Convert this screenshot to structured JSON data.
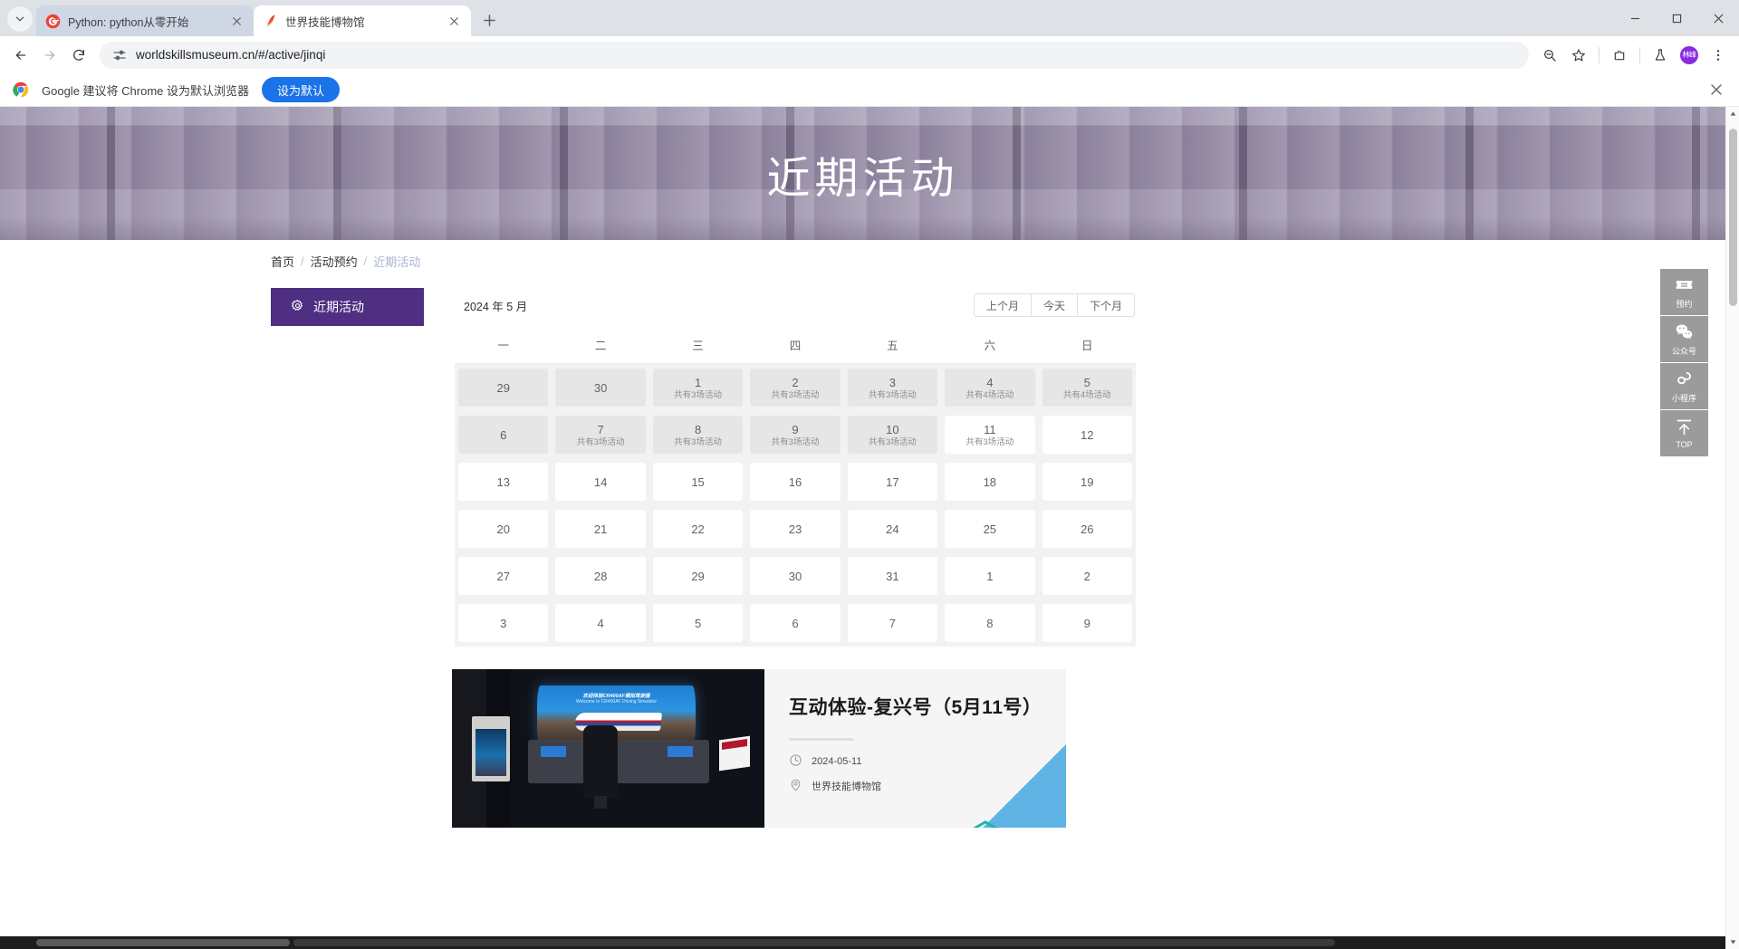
{
  "browser": {
    "tabs": [
      {
        "title": "Python: python从零开始",
        "favicon": "google-g-icon",
        "active": false
      },
      {
        "title": "世界技能博物馆",
        "favicon": "museum-icon",
        "active": true
      }
    ],
    "new_tab_label": "+",
    "url": "worldskillsmuseum.cn/#/active/jinqi",
    "profile_initials": "林峰",
    "window_controls": {
      "minimize": "minimize",
      "maximize": "maximize",
      "close": "close"
    },
    "toolbar_icons": [
      "back-icon",
      "forward-icon",
      "reload-icon",
      "site-info-icon",
      "zoom-out-icon",
      "bookmark-star-icon",
      "extensions-icon",
      "labs-flask-icon",
      "profile-avatar",
      "more-menu-icon"
    ]
  },
  "infobar": {
    "message": "Google 建议将 Chrome 设为默认浏览器",
    "button": "设为默认"
  },
  "hero": {
    "title": "近期活动"
  },
  "breadcrumb": {
    "home": "首页",
    "sep1": "/",
    "section": "活动预约",
    "sep2": "/",
    "current": "近期活动"
  },
  "side_menu": {
    "items": [
      {
        "label": "近期活动",
        "icon": "gear-icon",
        "active": true
      }
    ]
  },
  "calendar": {
    "month_label": "2024 年 5 月",
    "nav": {
      "prev": "上个月",
      "today": "今天",
      "next": "下个月"
    },
    "weekdays": [
      "一",
      "二",
      "三",
      "四",
      "五",
      "六",
      "日"
    ],
    "weeks": [
      [
        {
          "day": "29",
          "events": "",
          "muted": true
        },
        {
          "day": "30",
          "events": "",
          "muted": true
        },
        {
          "day": "1",
          "events": "共有3场活动",
          "muted": true
        },
        {
          "day": "2",
          "events": "共有3场活动",
          "muted": true
        },
        {
          "day": "3",
          "events": "共有3场活动",
          "muted": true
        },
        {
          "day": "4",
          "events": "共有4场活动",
          "muted": true
        },
        {
          "day": "5",
          "events": "共有4场活动",
          "muted": true
        }
      ],
      [
        {
          "day": "6",
          "events": "",
          "muted": true
        },
        {
          "day": "7",
          "events": "共有3场活动",
          "muted": true
        },
        {
          "day": "8",
          "events": "共有3场活动",
          "muted": true
        },
        {
          "day": "9",
          "events": "共有3场活动",
          "muted": true
        },
        {
          "day": "10",
          "events": "共有3场活动",
          "muted": true
        },
        {
          "day": "11",
          "events": "共有3场活动",
          "muted": false
        },
        {
          "day": "12",
          "events": "",
          "muted": false
        }
      ],
      [
        {
          "day": "13",
          "events": "",
          "muted": false
        },
        {
          "day": "14",
          "events": "",
          "muted": false
        },
        {
          "day": "15",
          "events": "",
          "muted": false
        },
        {
          "day": "16",
          "events": "",
          "muted": false
        },
        {
          "day": "17",
          "events": "",
          "muted": false
        },
        {
          "day": "18",
          "events": "",
          "muted": false
        },
        {
          "day": "19",
          "events": "",
          "muted": false
        }
      ],
      [
        {
          "day": "20",
          "events": "",
          "muted": false
        },
        {
          "day": "21",
          "events": "",
          "muted": false
        },
        {
          "day": "22",
          "events": "",
          "muted": false
        },
        {
          "day": "23",
          "events": "",
          "muted": false
        },
        {
          "day": "24",
          "events": "",
          "muted": false
        },
        {
          "day": "25",
          "events": "",
          "muted": false
        },
        {
          "day": "26",
          "events": "",
          "muted": false
        }
      ],
      [
        {
          "day": "27",
          "events": "",
          "muted": false
        },
        {
          "day": "28",
          "events": "",
          "muted": false
        },
        {
          "day": "29",
          "events": "",
          "muted": false
        },
        {
          "day": "30",
          "events": "",
          "muted": false
        },
        {
          "day": "31",
          "events": "",
          "muted": false
        },
        {
          "day": "1",
          "events": "",
          "muted": false
        },
        {
          "day": "2",
          "events": "",
          "muted": false
        }
      ],
      [
        {
          "day": "3",
          "events": "",
          "muted": false
        },
        {
          "day": "4",
          "events": "",
          "muted": false
        },
        {
          "day": "5",
          "events": "",
          "muted": false
        },
        {
          "day": "6",
          "events": "",
          "muted": false
        },
        {
          "day": "7",
          "events": "",
          "muted": false
        },
        {
          "day": "8",
          "events": "",
          "muted": false
        },
        {
          "day": "9",
          "events": "",
          "muted": false
        }
      ]
    ]
  },
  "event_card": {
    "title": "互动体验-复兴号（5月11号）",
    "date": "2024-05-11",
    "location": "世界技能博物馆",
    "photo_caption_cn": "欢迎体验CR400AF模拟驾驶器",
    "photo_caption_en": "Welcome to CR400AF Driving Simulator"
  },
  "rail": {
    "items": [
      {
        "label": "预约",
        "icon": "ticket-icon"
      },
      {
        "label": "公众号",
        "icon": "wechat-icon"
      },
      {
        "label": "小程序",
        "icon": "miniprogram-icon"
      },
      {
        "label": "TOP",
        "icon": "arrow-up-icon"
      }
    ]
  },
  "colors": {
    "brand_purple": "#4e2f82",
    "chrome_blue": "#1a73e8",
    "card_accent": "#5eb3e4"
  }
}
